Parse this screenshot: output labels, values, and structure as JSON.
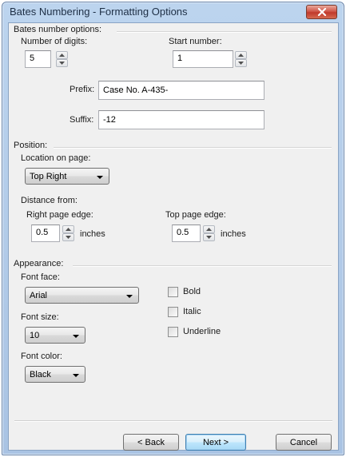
{
  "window": {
    "title": "Bates Numbering - Formatting Options",
    "close_icon": "close-x-icon"
  },
  "bates_options": {
    "group_label": "Bates number options:",
    "digits_label": "Number of digits:",
    "digits_value": "5",
    "start_label": "Start number:",
    "start_value": "1",
    "prefix_label": "Prefix:",
    "prefix_value": "Case No. A-435-",
    "suffix_label": "Suffix:",
    "suffix_value": "-12"
  },
  "position": {
    "group_label": "Position:",
    "location_label": "Location on page:",
    "location_value": "Top Right",
    "distance_label": "Distance from:",
    "right_edge_label": "Right page edge:",
    "right_edge_value": "0.5",
    "top_edge_label": "Top page edge:",
    "top_edge_value": "0.5",
    "units_label": "inches"
  },
  "appearance": {
    "group_label": "Appearance:",
    "font_face_label": "Font face:",
    "font_face_value": "Arial",
    "font_size_label": "Font size:",
    "font_size_value": "10",
    "font_color_label": "Font color:",
    "font_color_value": "Black",
    "bold_label": "Bold",
    "bold_checked": false,
    "italic_label": "Italic",
    "italic_checked": false,
    "underline_label": "Underline",
    "underline_checked": false
  },
  "buttons": {
    "back_label": "< Back",
    "next_label": "Next >",
    "cancel_label": "Cancel"
  },
  "colors": {
    "titlebar": "#bcd4ee",
    "client_background": "#f0f0f0",
    "close_button": "#c0392b",
    "default_button_border": "#3c7fb1"
  }
}
